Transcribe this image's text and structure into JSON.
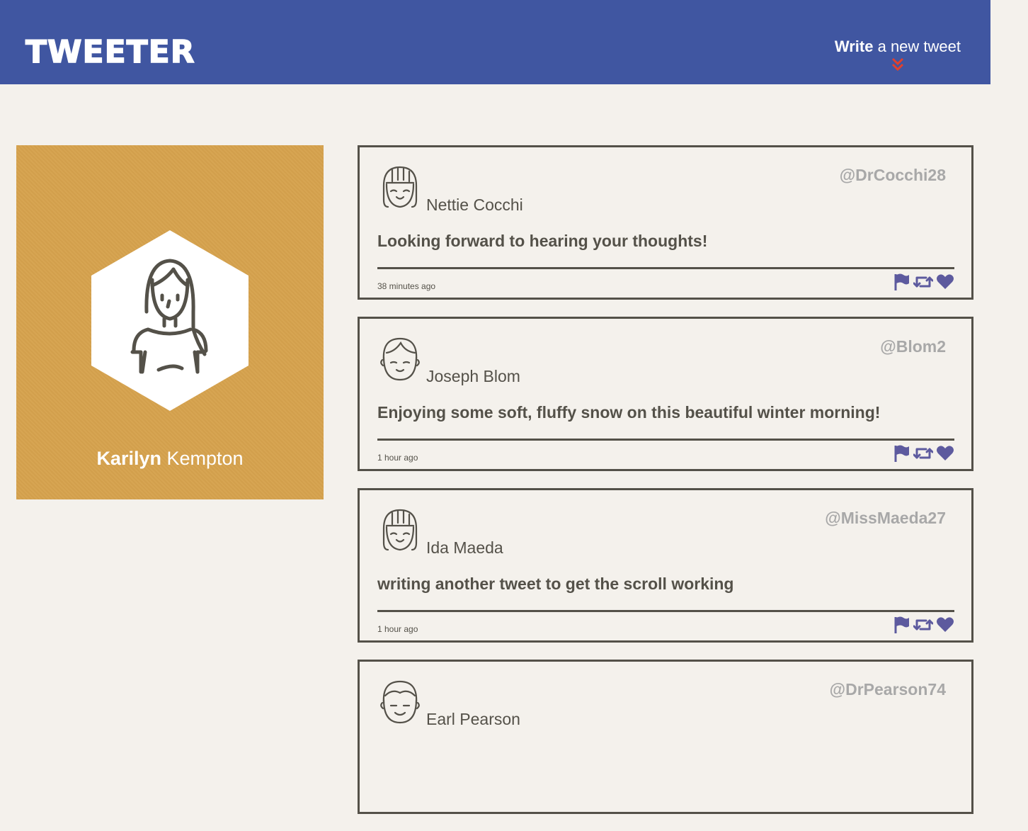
{
  "nav": {
    "logo": "TWEETER",
    "compose_bold": "Write",
    "compose_rest": " a new tweet"
  },
  "profile": {
    "first_name": "Karilyn",
    "last_name": " Kempton"
  },
  "colors": {
    "nav_bg": "#4056a1",
    "page_bg": "#f4f1ec",
    "profile_bg": "#d6a24d",
    "text": "#545149",
    "handle": "#a8a8a8",
    "icon": "#5d5a9e",
    "arrow": "#e0412d"
  },
  "tweets": [
    {
      "author": "Nettie Cocchi",
      "handle": "@DrCocchi28",
      "content": "Looking forward to hearing your thoughts!",
      "time": "38 minutes ago",
      "avatar": "girl-avatar-icon"
    },
    {
      "author": "Joseph Blom",
      "handle": "@Blom2",
      "content": "Enjoying some soft, fluffy snow on this beautiful winter morning!",
      "time": "1 hour ago",
      "avatar": "boy-avatar-icon"
    },
    {
      "author": "Ida Maeda",
      "handle": "@MissMaeda27",
      "content": "writing another tweet to get the scroll working",
      "time": "1 hour ago",
      "avatar": "girl-avatar-icon"
    },
    {
      "author": "Earl Pearson",
      "handle": "@DrPearson74",
      "content": "",
      "time": "",
      "avatar": "man-avatar-icon"
    }
  ]
}
